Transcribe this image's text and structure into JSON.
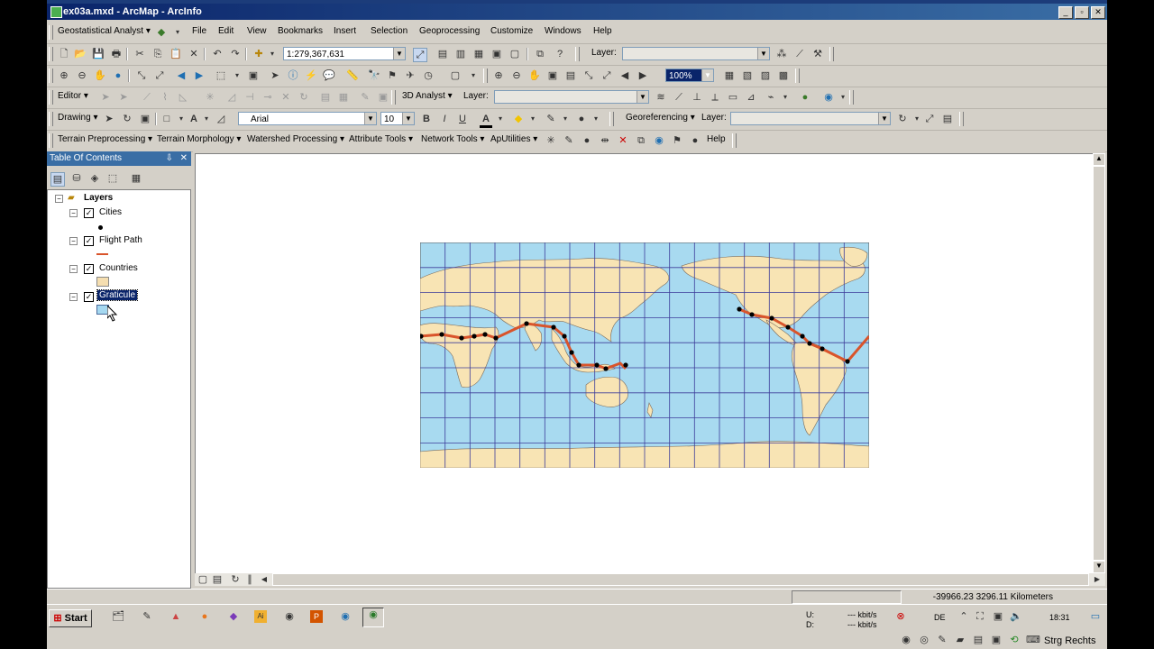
{
  "window": {
    "title": "ex03a.mxd - ArcMap - ArcInfo",
    "buttons": [
      "_",
      "▫",
      "✕"
    ]
  },
  "menubar": {
    "geostat_label": "Geostatistical Analyst ▾",
    "items": [
      "File",
      "Edit",
      "View",
      "Bookmarks",
      "Insert",
      "Selection",
      "Geoprocessing",
      "Customize",
      "Windows",
      "Help"
    ]
  },
  "standard_toolbar": {
    "scale_value": "1:279,367,631",
    "layer_label": "Layer:"
  },
  "tools_toolbar": {
    "zoom_value": "100%"
  },
  "editor_toolbar": {
    "editor_label": "Editor ▾",
    "analyst_label": "3D Analyst ▾",
    "layer_label": "Layer:"
  },
  "drawing_toolbar": {
    "drawing_label": "Drawing ▾",
    "font_name": "Arial",
    "font_size": "10",
    "bold": "B",
    "italic": "I",
    "underline": "U",
    "fontcolor": "A",
    "georef_label": "Georeferencing ▾",
    "layer_label": "Layer:"
  },
  "custom_toolbar": {
    "items": [
      "Terrain Preprocessing ▾",
      "Terrain Morphology ▾",
      "Watershed Processing ▾",
      "Attribute Tools ▾",
      "Network Tools ▾",
      "ApUtilities ▾"
    ],
    "help_label": "Help"
  },
  "toc": {
    "title": "Table Of Contents",
    "pin": "⇩",
    "close": "✕",
    "root": "Layers",
    "layers": [
      {
        "name": "Cities",
        "symbol": "point",
        "color": "#000000"
      },
      {
        "name": "Flight Path",
        "symbol": "line",
        "color": "#d9542b"
      },
      {
        "name": "Countries",
        "symbol": "fill",
        "color": "#f5deb0"
      },
      {
        "name": "Graticule",
        "symbol": "fill",
        "color": "#a5d8f0"
      }
    ]
  },
  "map": {
    "ocean_color": "#a8daf0",
    "land_color": "#f8e4b4",
    "route_color": "#d9542b",
    "city_color": "#000000"
  },
  "statusbar": {
    "coordinates": "-39966.23  3296.11 Kilometers"
  },
  "taskbar": {
    "start_label": "Start",
    "net_up": "U:",
    "net_down": "D:",
    "rate_up": "--- kbit/s",
    "rate_down": "--- kbit/s",
    "lang": "DE",
    "clock": "18:31",
    "strg": "Strg Rechts"
  }
}
